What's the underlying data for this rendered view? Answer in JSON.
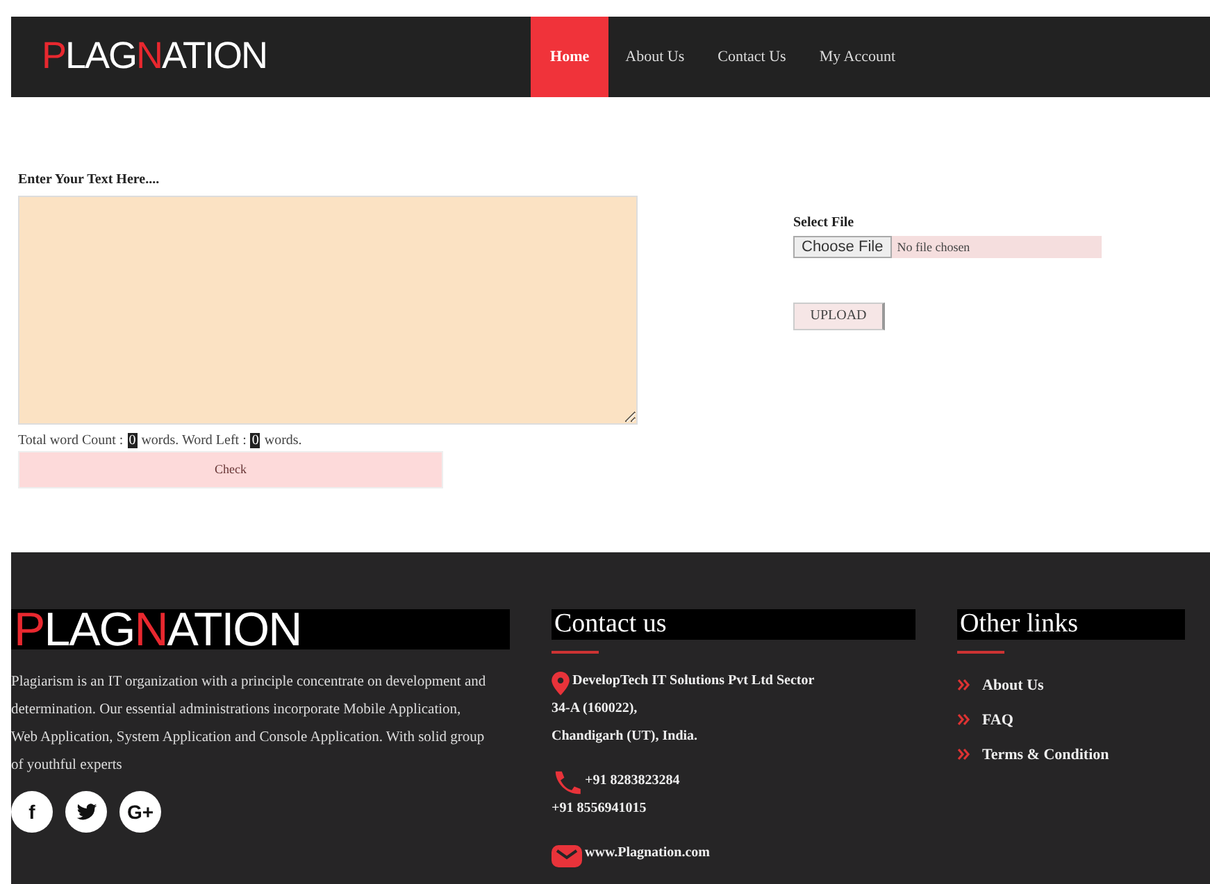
{
  "header": {
    "logo": [
      {
        "text": "P",
        "kind": "mark"
      },
      {
        "text": "LAG",
        "kind": "plain"
      },
      {
        "text": "N",
        "kind": "accent"
      },
      {
        "text": "ATION",
        "kind": "plain"
      }
    ],
    "nav": [
      {
        "label": "Home",
        "selected": true
      },
      {
        "label": "About Us",
        "selected": false
      },
      {
        "label": "Contact Us",
        "selected": false
      },
      {
        "label": "My Account",
        "selected": false
      }
    ]
  },
  "text_form": {
    "label": "Enter Your Text Here....",
    "count_parts": [
      {
        "text": "Total word Count :",
        "kind": "text"
      },
      {
        "text": "0",
        "kind": "number"
      },
      {
        "text": "words. Word Left :",
        "kind": "text"
      },
      {
        "text": "0",
        "kind": "number"
      },
      {
        "text": "words.",
        "kind": "text"
      }
    ],
    "button": "Check"
  },
  "file_form": {
    "label": "Select File",
    "choose_button": "Choose File",
    "file_status": "No file chosen",
    "button": "UPLOAD"
  },
  "footer": {
    "logo": [
      {
        "text": "P",
        "kind": "mark"
      },
      {
        "text": "LAG",
        "kind": "plain"
      },
      {
        "text": "N",
        "kind": "accent"
      },
      {
        "text": "ATION",
        "kind": "plain"
      }
    ],
    "about": "Plagiarism is an IT organization with a principle concentrate on development and determination. Our essential administrations incorporate Mobile Application, Web Application, System Application and Console Application. With solid group of youthful experts",
    "social": [
      {
        "kind": "facebook",
        "label": "f"
      },
      {
        "kind": "twitter"
      },
      {
        "kind": "google",
        "label": "G+"
      }
    ],
    "contact": {
      "title": "Contact us",
      "items": [
        {
          "kind": "pin",
          "lines": [
            "DevelopTech IT Solutions Pvt Ltd Sector",
            "34-A (160022),",
            "Chandigarh (UT), India."
          ]
        },
        {
          "kind": "phone",
          "lines": [
            "+91 8283823284",
            "+91 8556941015"
          ]
        },
        {
          "kind": "mail",
          "lines": [
            "www.Plagnation.com"
          ]
        }
      ]
    },
    "links": {
      "title": "Other links",
      "items": [
        "About Us",
        "FAQ",
        "Terms & Condition"
      ]
    }
  }
}
